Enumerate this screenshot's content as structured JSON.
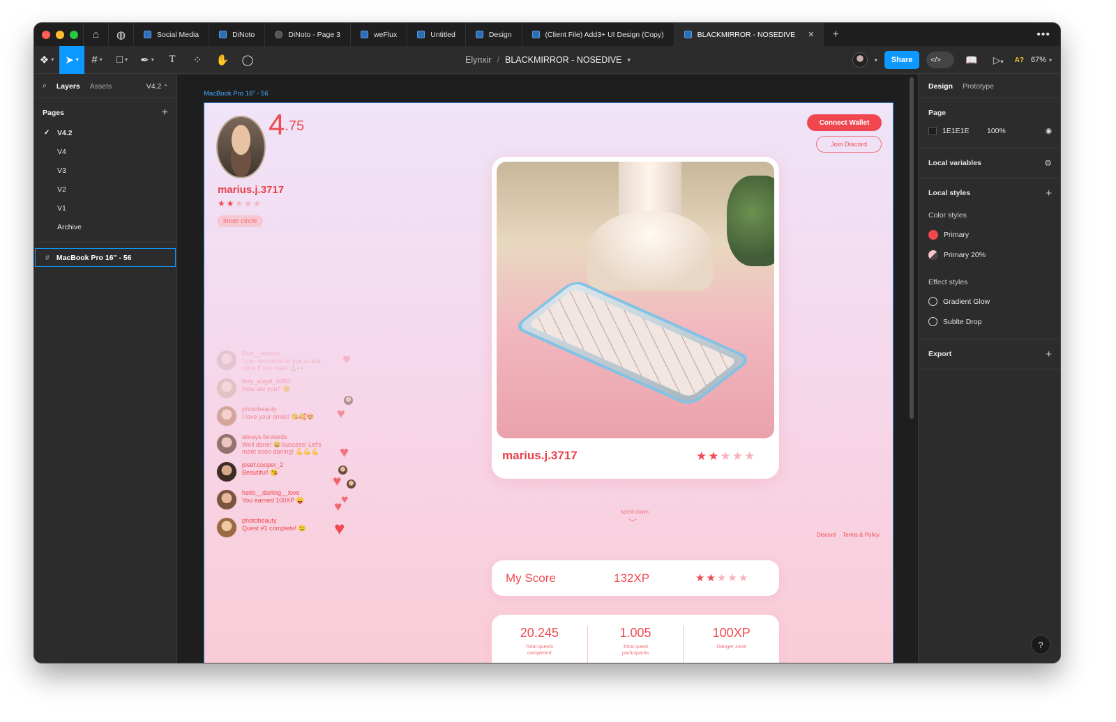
{
  "tabs": [
    {
      "label": "Social Media",
      "icon": "figma-file-icon"
    },
    {
      "label": "DiNoto",
      "icon": "figma-file-icon"
    },
    {
      "label": "DiNoto - Page 3",
      "icon": "play-icon"
    },
    {
      "label": "weFlux",
      "icon": "figma-file-icon"
    },
    {
      "label": "Untitled",
      "icon": "figma-file-icon"
    },
    {
      "label": "Design",
      "icon": "figma-file-icon"
    },
    {
      "label": "(Client File) Add3+ UI Design (Copy)",
      "icon": "figma-file-icon"
    },
    {
      "label": "BLACKMIRROR - NOSEDIVE",
      "icon": "figma-file-icon",
      "active": true
    }
  ],
  "toolbar": {
    "team": "Elynxir",
    "separator": "/",
    "file": "BLACKMIRROR - NOSEDIVE",
    "share_label": "Share",
    "aq_label": "A?",
    "zoom": "67%"
  },
  "left_panel": {
    "tab_layers": "Layers",
    "tab_assets": "Assets",
    "version": "V4.2",
    "pages_title": "Pages",
    "pages": [
      "V4.2",
      "V4",
      "V3",
      "V2",
      "V1",
      "Archive"
    ],
    "selected_page": "V4.2",
    "frame_layer": "MacBook Pro 16\" - 56"
  },
  "right_panel": {
    "tab_design": "Design",
    "tab_prototype": "Prototype",
    "page_title": "Page",
    "page_color": "1E1E1E",
    "page_opacity": "100%",
    "local_variables": "Local variables",
    "local_styles": "Local styles",
    "color_styles": "Color styles",
    "colors": [
      {
        "name": "Primary",
        "hex": "#f0464e"
      },
      {
        "name": "Primary 20%",
        "hex": "#f0464e"
      }
    ],
    "effect_styles": "Effect styles",
    "effects": [
      "Gradient Glow",
      "Sublte Drop"
    ],
    "export": "Export"
  },
  "canvas": {
    "frame_label": "MacBook Pro 16\" - 56",
    "help": "?"
  },
  "design": {
    "score_main": "4",
    "score_decimal": ".75",
    "username": "marius.j.3717",
    "rating": 2,
    "max_rating": 5,
    "badge": "inner circle",
    "connect_wallet": "Connect Wallet",
    "join_discord": "Join Discord",
    "card_username": "marius.j.3717",
    "scroll_hint": "scroll down",
    "footer_discord": "Discord",
    "footer_terms": "Terms & Policy",
    "my_score_label": "My Score",
    "my_score_xp": "132XP",
    "stats": [
      {
        "value": "20.245",
        "label": "Total quests completed"
      },
      {
        "value": "1.005",
        "label": "Total quest participants"
      },
      {
        "value": "100XP",
        "label": "Danger zone"
      }
    ],
    "comments": [
      {
        "user": "l0ve__winsss",
        "text": "I can recommend you a nice clinic if you want 🙏👀"
      },
      {
        "user": "holy_angel_4000",
        "text": "How are you? 😊"
      },
      {
        "user": "photobeauty",
        "text": "I love your smile! 😘🥰😍"
      },
      {
        "user": "always.forwards",
        "text": "Well done! 😃Success! Let's meet soon darling! 💪💪💪"
      },
      {
        "user": "josef.cooper_2",
        "text": "Beautiful! 😘"
      },
      {
        "user": "hello__darling__love",
        "text": "You earned 100XP 😛"
      },
      {
        "user": "photobeauty",
        "text": "Quest #1 complete! 😉"
      }
    ]
  },
  "colors": {
    "accent": "#0d99ff",
    "primary": "#f0464e",
    "star_off": "#f7b3bd"
  }
}
